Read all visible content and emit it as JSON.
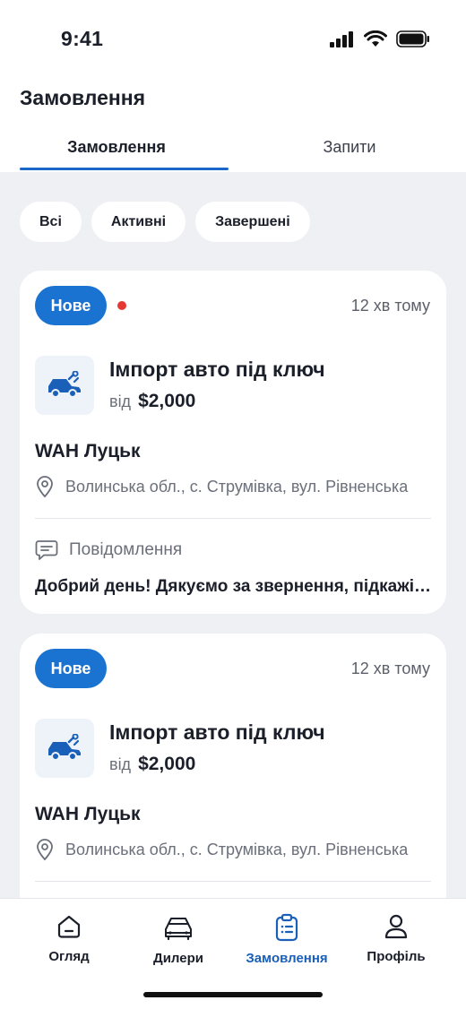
{
  "status_bar": {
    "time": "9:41"
  },
  "page_title": "Замовлення",
  "tabs": [
    {
      "label": "Замовлення",
      "active": true
    },
    {
      "label": "Запити",
      "active": false
    }
  ],
  "filters": [
    {
      "label": "Всі"
    },
    {
      "label": "Активні"
    },
    {
      "label": "Завершені"
    }
  ],
  "orders": [
    {
      "badge": "Нове",
      "unread": true,
      "time_ago": "12 хв тому",
      "service_title": "Імпорт авто під ключ",
      "price_prefix": "від",
      "price": "$2,000",
      "dealer": "WAH Луцьк",
      "address": "Волинська обл., с. Струмівка, вул. Рівненська",
      "message_label": "Повідомлення",
      "message_text": "Добрий день! Дякуємо за звернення, підкажіть будь ласка"
    },
    {
      "badge": "Нове",
      "unread": false,
      "time_ago": "12 хв тому",
      "service_title": "Імпорт авто під ключ",
      "price_prefix": "від",
      "price": "$2,000",
      "dealer": "WAH Луцьк",
      "address": "Волинська обл., с. Струмівка, вул. Рівненська"
    }
  ],
  "bottom_nav": [
    {
      "label": "Огляд",
      "icon": "home-icon"
    },
    {
      "label": "Дилери",
      "icon": "cars-icon"
    },
    {
      "label": "Замовлення",
      "icon": "clipboard-icon",
      "active": true
    },
    {
      "label": "Профіль",
      "icon": "user-icon"
    }
  ],
  "colors": {
    "accent": "#1a73d1",
    "active_nav": "#1a5fb8",
    "unread_dot": "#e53935"
  }
}
